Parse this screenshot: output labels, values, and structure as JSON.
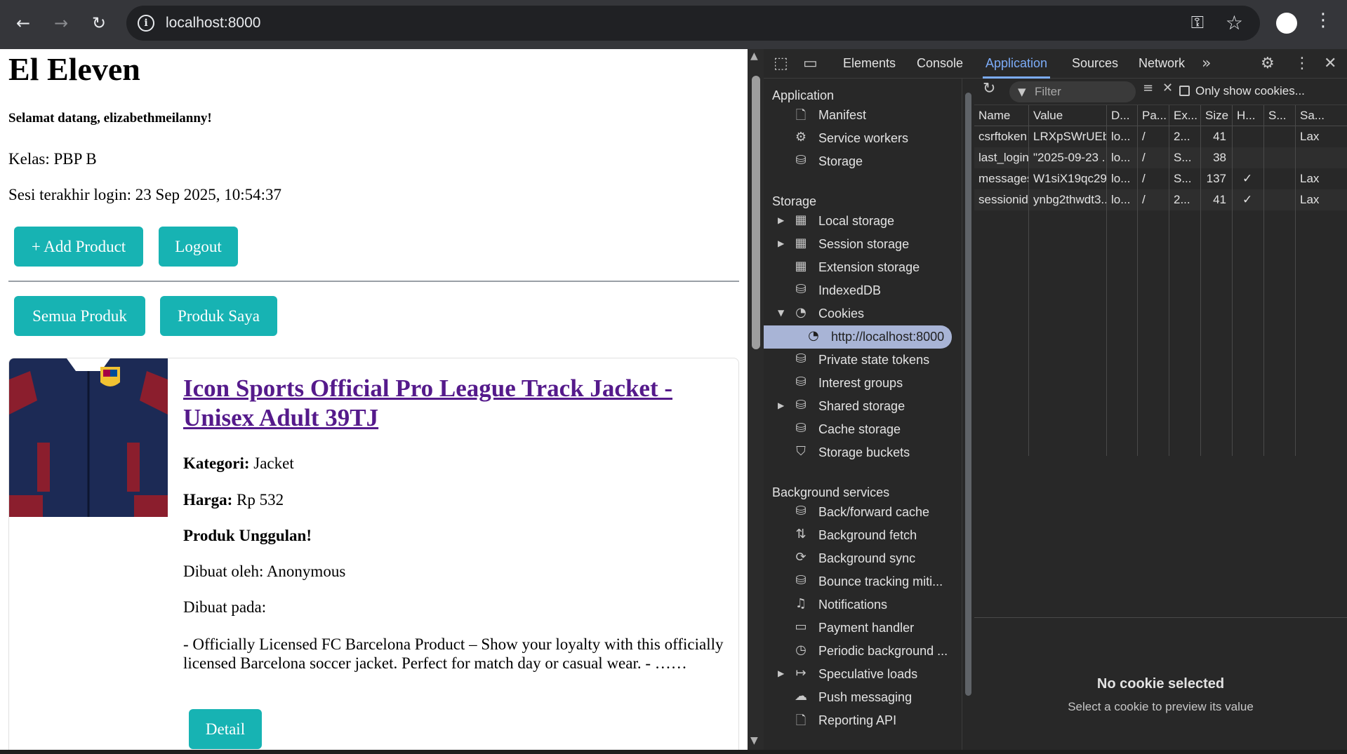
{
  "browser": {
    "url": "localhost:8000",
    "back_icon": "←",
    "forward_icon": "→",
    "reload_icon": "↻"
  },
  "page": {
    "title": "El Eleven",
    "welcome": "Selamat datang, elizabethmeilanny!",
    "kelas": "Kelas: PBP B",
    "last_login": "Sesi terakhir login: 23 Sep 2025, 10:54:37",
    "buttons": {
      "add_product": "+ Add Product",
      "logout": "Logout",
      "semua_produk": "Semua Produk",
      "produk_saya": "Produk Saya",
      "detail": "Detail"
    },
    "product": {
      "name": "Icon Sports Official Pro League Track Jacket - Unisex Adult 39TJ",
      "kategori_label": "Kategori:",
      "kategori": "Jacket",
      "harga_label": "Harga:",
      "harga": "Rp 532",
      "featured": "Produk Unggulan!",
      "created_by": "Dibuat oleh: Anonymous",
      "created_at": "Dibuat pada:",
      "description": "- Officially Licensed FC Barcelona Product – Show your loyalty with this officially licensed Barcelona soccer jacket. Perfect for match day or casual wear. - ……"
    }
  },
  "devtools": {
    "tabs": [
      "Elements",
      "Console",
      "Application",
      "Sources",
      "Network"
    ],
    "active_tab": "Application",
    "more_tabs": "»",
    "sidebar": {
      "application_header": "Application",
      "application_items": [
        "Manifest",
        "Service workers",
        "Storage"
      ],
      "storage_header": "Storage",
      "storage_items": [
        "Local storage",
        "Session storage",
        "Extension storage",
        "IndexedDB",
        "Cookies",
        "http://localhost:8000",
        "Private state tokens",
        "Interest groups",
        "Shared storage",
        "Cache storage",
        "Storage buckets"
      ],
      "background_header": "Background services",
      "background_items": [
        "Back/forward cache",
        "Background fetch",
        "Background sync",
        "Bounce tracking miti...",
        "Notifications",
        "Payment handler",
        "Periodic background ...",
        "Speculative loads",
        "Push messaging",
        "Reporting API"
      ]
    },
    "cookies": {
      "filter_placeholder": "Filter",
      "only_show": "Only show cookies...",
      "columns": [
        "Name",
        "Value",
        "D...",
        "Pa...",
        "Ex...",
        "Size",
        "H...",
        "S...",
        "Sa..."
      ],
      "rows": [
        [
          "csrftoken",
          "LRXpSWrUEb...",
          "lo...",
          "/",
          "2...",
          "41",
          "",
          "",
          "Lax"
        ],
        [
          "last_login",
          "\"2025-09-23 ...",
          "lo...",
          "/",
          "S...",
          "38",
          "",
          "",
          ""
        ],
        [
          "messages",
          "W1siX19qc29...",
          "lo...",
          "/",
          "S...",
          "137",
          "✓",
          "",
          "Lax"
        ],
        [
          "sessionid",
          "ynbg2thwdt3...",
          "lo...",
          "/",
          "2...",
          "41",
          "✓",
          "",
          "Lax"
        ]
      ],
      "empty_title": "No cookie selected",
      "empty_sub": "Select a cookie to preview its value"
    }
  }
}
